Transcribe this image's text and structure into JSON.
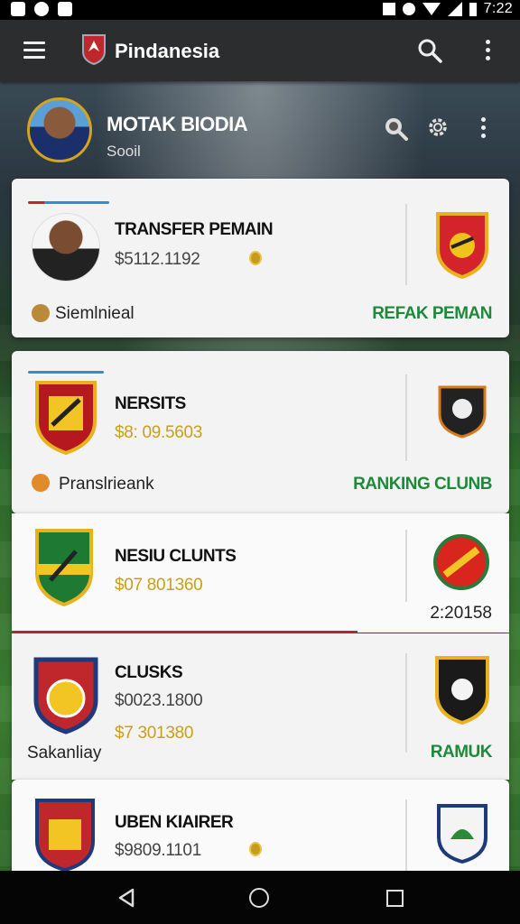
{
  "status_bar": {
    "time": "7:22"
  },
  "app_bar": {
    "title": "Pindanesia"
  },
  "profile": {
    "name": "MOTAK BIODIA",
    "subtitle": "Sooil"
  },
  "cards": [
    {
      "title": "TRANSFER PEMAIN",
      "amount": "$5112.1192",
      "footer_left": "Siemlnieal",
      "action": "REFAK PEMAN"
    },
    {
      "title": "NERSITS",
      "amount": "$8: 09.5603",
      "footer_left": "Pranslrieank",
      "action": "RANKING CLUNB"
    },
    {
      "title": "NESIU CLUNTS",
      "amount": "$07 801360",
      "value_right": "2:20158"
    },
    {
      "title": "CLUSKS",
      "amount": "$0023.1800",
      "amount2": "$7 301380",
      "footer_left": "Sakanliay",
      "action": "RAMUK"
    },
    {
      "title": "UBEN KIAIRER",
      "amount": "$9809.1101"
    }
  ],
  "colors": {
    "accent_green": "#1d8a3a",
    "gold": "#c8a018",
    "red": "#c0272d",
    "blue": "#2b8fd6"
  }
}
